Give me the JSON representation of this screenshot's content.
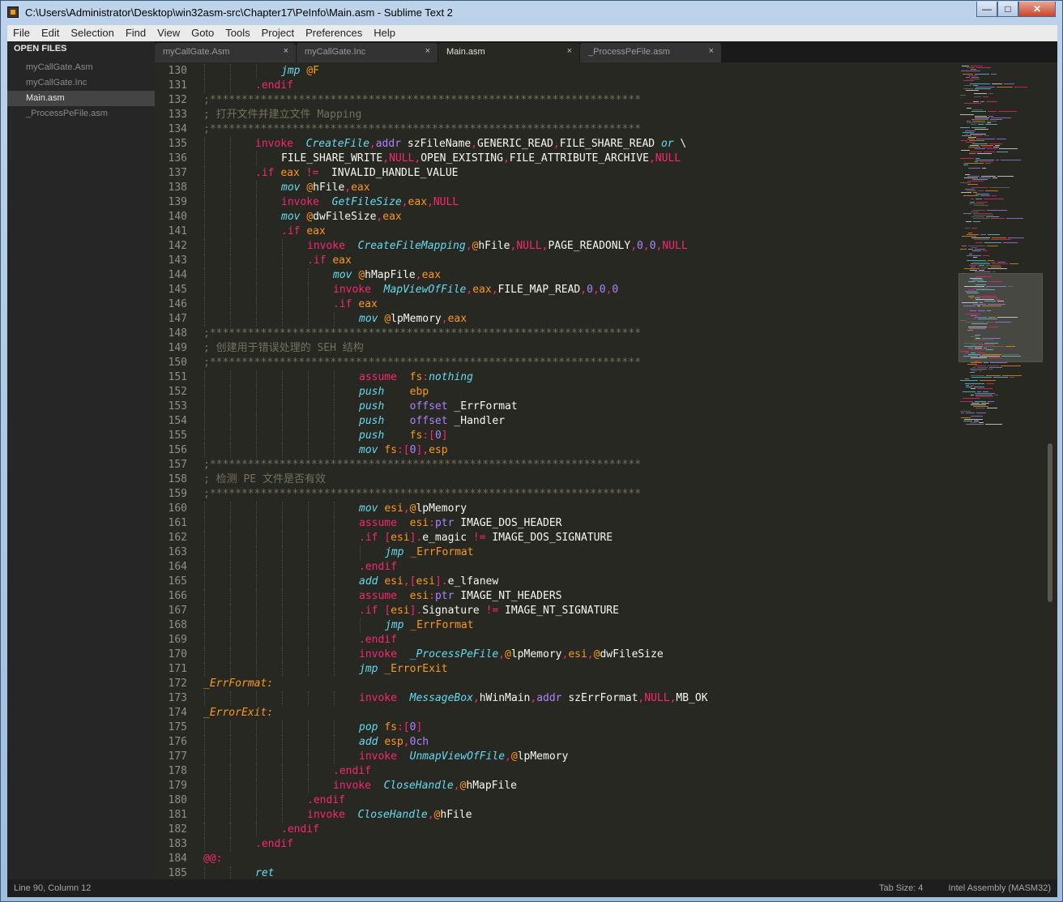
{
  "window": {
    "title": "C:\\Users\\Administrator\\Desktop\\win32asm-src\\Chapter17\\PeInfo\\Main.asm - Sublime Text 2"
  },
  "menu": [
    "File",
    "Edit",
    "Selection",
    "Find",
    "View",
    "Goto",
    "Tools",
    "Project",
    "Preferences",
    "Help"
  ],
  "sidebar": {
    "header": "OPEN FILES",
    "items": [
      "myCallGate.Asm",
      "myCallGate.Inc",
      "Main.asm",
      "_ProcessPeFile.asm"
    ],
    "active_index": 2
  },
  "tabs": [
    "myCallGate.Asm",
    "myCallGate.Inc",
    "Main.asm",
    "_ProcessPeFile.asm"
  ],
  "active_tab": 2,
  "tab_close_glyph": "×",
  "colors": {
    "keyword": "#f92672",
    "function": "#66d9ef",
    "directive": "#ae81ff",
    "string_like": "#fd971f",
    "comment": "#75715e",
    "plain": "#f8f8f2",
    "number": "#ae81ff",
    "background": "#272822"
  },
  "code_lines": [
    {
      "n": 130,
      "indent": 3,
      "tokens": [
        [
          "jmp",
          "fn"
        ],
        [
          " ",
          "p"
        ],
        [
          "@F",
          "or"
        ]
      ]
    },
    {
      "n": 131,
      "indent": 2,
      "tokens": [
        [
          ".endif",
          "kw"
        ]
      ]
    },
    {
      "n": 132,
      "indent": 0,
      "tokens": [
        [
          ";********************************************************************",
          "cm"
        ]
      ]
    },
    {
      "n": 133,
      "indent": 0,
      "tokens": [
        [
          "; 打开文件并建立文件 Mapping",
          "cm"
        ]
      ]
    },
    {
      "n": 134,
      "indent": 0,
      "tokens": [
        [
          ";********************************************************************",
          "cm"
        ]
      ]
    },
    {
      "n": 135,
      "indent": 2,
      "tokens": [
        [
          "invoke",
          "kw"
        ],
        [
          "  ",
          "p"
        ],
        [
          "CreateFile",
          "fn"
        ],
        [
          ",",
          "kw"
        ],
        [
          "addr",
          "di"
        ],
        [
          " szFileName",
          "p"
        ],
        [
          ",",
          "kw"
        ],
        [
          "GENERIC_READ",
          "p"
        ],
        [
          ",",
          "kw"
        ],
        [
          "FILE_SHARE_READ ",
          "p"
        ],
        [
          "or",
          "fn"
        ],
        [
          " \\",
          "p"
        ]
      ]
    },
    {
      "n": 136,
      "indent": 3,
      "tokens": [
        [
          "FILE_SHARE_WRITE",
          "p"
        ],
        [
          ",",
          "kw"
        ],
        [
          "NULL",
          "kw"
        ],
        [
          ",",
          "kw"
        ],
        [
          "OPEN_EXISTING",
          "p"
        ],
        [
          ",",
          "kw"
        ],
        [
          "FILE_ATTRIBUTE_ARCHIVE",
          "p"
        ],
        [
          ",",
          "kw"
        ],
        [
          "NULL",
          "kw"
        ]
      ]
    },
    {
      "n": 137,
      "indent": 2,
      "tokens": [
        [
          ".if",
          "kw"
        ],
        [
          " ",
          "p"
        ],
        [
          "eax",
          "or"
        ],
        [
          " ",
          "p"
        ],
        [
          "!=",
          "kw"
        ],
        [
          "  INVALID_HANDLE_VALUE",
          "p"
        ]
      ]
    },
    {
      "n": 138,
      "indent": 3,
      "tokens": [
        [
          "mov",
          "fn"
        ],
        [
          " ",
          "p"
        ],
        [
          "@",
          "or"
        ],
        [
          "hFile",
          "p"
        ],
        [
          ",",
          "kw"
        ],
        [
          "eax",
          "or"
        ]
      ]
    },
    {
      "n": 139,
      "indent": 3,
      "tokens": [
        [
          "invoke",
          "kw"
        ],
        [
          "  ",
          "p"
        ],
        [
          "GetFileSize",
          "fn"
        ],
        [
          ",",
          "kw"
        ],
        [
          "eax",
          "or"
        ],
        [
          ",",
          "kw"
        ],
        [
          "NULL",
          "kw"
        ]
      ]
    },
    {
      "n": 140,
      "indent": 3,
      "tokens": [
        [
          "mov",
          "fn"
        ],
        [
          " ",
          "p"
        ],
        [
          "@",
          "or"
        ],
        [
          "dwFileSize",
          "p"
        ],
        [
          ",",
          "kw"
        ],
        [
          "eax",
          "or"
        ]
      ]
    },
    {
      "n": 141,
      "indent": 3,
      "tokens": [
        [
          ".if",
          "kw"
        ],
        [
          " ",
          "p"
        ],
        [
          "eax",
          "or"
        ]
      ]
    },
    {
      "n": 142,
      "indent": 4,
      "tokens": [
        [
          "invoke",
          "kw"
        ],
        [
          "  ",
          "p"
        ],
        [
          "CreateFileMapping",
          "fn"
        ],
        [
          ",",
          "kw"
        ],
        [
          "@",
          "or"
        ],
        [
          "hFile",
          "p"
        ],
        [
          ",",
          "kw"
        ],
        [
          "NULL",
          "kw"
        ],
        [
          ",",
          "kw"
        ],
        [
          "PAGE_READONLY",
          "p"
        ],
        [
          ",",
          "kw"
        ],
        [
          "0",
          "di"
        ],
        [
          ",",
          "kw"
        ],
        [
          "0",
          "di"
        ],
        [
          ",",
          "kw"
        ],
        [
          "NULL",
          "kw"
        ]
      ]
    },
    {
      "n": 143,
      "indent": 4,
      "tokens": [
        [
          ".if",
          "kw"
        ],
        [
          " ",
          "p"
        ],
        [
          "eax",
          "or"
        ]
      ]
    },
    {
      "n": 144,
      "indent": 5,
      "tokens": [
        [
          "mov",
          "fn"
        ],
        [
          " ",
          "p"
        ],
        [
          "@",
          "or"
        ],
        [
          "hMapFile",
          "p"
        ],
        [
          ",",
          "kw"
        ],
        [
          "eax",
          "or"
        ]
      ]
    },
    {
      "n": 145,
      "indent": 5,
      "tokens": [
        [
          "invoke",
          "kw"
        ],
        [
          "  ",
          "p"
        ],
        [
          "MapViewOfFile",
          "fn"
        ],
        [
          ",",
          "kw"
        ],
        [
          "eax",
          "or"
        ],
        [
          ",",
          "kw"
        ],
        [
          "FILE_MAP_READ",
          "p"
        ],
        [
          ",",
          "kw"
        ],
        [
          "0",
          "di"
        ],
        [
          ",",
          "kw"
        ],
        [
          "0",
          "di"
        ],
        [
          ",",
          "kw"
        ],
        [
          "0",
          "di"
        ]
      ]
    },
    {
      "n": 146,
      "indent": 5,
      "tokens": [
        [
          ".if",
          "kw"
        ],
        [
          " ",
          "p"
        ],
        [
          "eax",
          "or"
        ]
      ]
    },
    {
      "n": 147,
      "indent": 6,
      "tokens": [
        [
          "mov",
          "fn"
        ],
        [
          " ",
          "p"
        ],
        [
          "@",
          "or"
        ],
        [
          "lpMemory",
          "p"
        ],
        [
          ",",
          "kw"
        ],
        [
          "eax",
          "or"
        ]
      ]
    },
    {
      "n": 148,
      "indent": 0,
      "tokens": [
        [
          ";********************************************************************",
          "cm"
        ]
      ]
    },
    {
      "n": 149,
      "indent": 0,
      "tokens": [
        [
          "; 创建用于错误处理的 SEH 结构",
          "cm"
        ]
      ]
    },
    {
      "n": 150,
      "indent": 0,
      "tokens": [
        [
          ";********************************************************************",
          "cm"
        ]
      ]
    },
    {
      "n": 151,
      "indent": 6,
      "tokens": [
        [
          "assume",
          "kw"
        ],
        [
          "  ",
          "p"
        ],
        [
          "fs",
          "or"
        ],
        [
          ":",
          "kw"
        ],
        [
          "nothing",
          "fn"
        ]
      ]
    },
    {
      "n": 152,
      "indent": 6,
      "tokens": [
        [
          "push",
          "fn"
        ],
        [
          "    ",
          "p"
        ],
        [
          "ebp",
          "or"
        ]
      ]
    },
    {
      "n": 153,
      "indent": 6,
      "tokens": [
        [
          "push",
          "fn"
        ],
        [
          "    ",
          "p"
        ],
        [
          "offset",
          "di"
        ],
        [
          " _ErrFormat",
          "p"
        ]
      ]
    },
    {
      "n": 154,
      "indent": 6,
      "tokens": [
        [
          "push",
          "fn"
        ],
        [
          "    ",
          "p"
        ],
        [
          "offset",
          "di"
        ],
        [
          " _Handler",
          "p"
        ]
      ]
    },
    {
      "n": 155,
      "indent": 6,
      "tokens": [
        [
          "push",
          "fn"
        ],
        [
          "    ",
          "p"
        ],
        [
          "fs",
          "or"
        ],
        [
          ":[",
          "kw"
        ],
        [
          "0",
          "di"
        ],
        [
          "]",
          "kw"
        ]
      ]
    },
    {
      "n": 156,
      "indent": 6,
      "tokens": [
        [
          "mov",
          "fn"
        ],
        [
          " ",
          "p"
        ],
        [
          "fs",
          "or"
        ],
        [
          ":[",
          "kw"
        ],
        [
          "0",
          "di"
        ],
        [
          "],",
          "kw"
        ],
        [
          "esp",
          "or"
        ]
      ]
    },
    {
      "n": 157,
      "indent": 0,
      "tokens": [
        [
          ";********************************************************************",
          "cm"
        ]
      ]
    },
    {
      "n": 158,
      "indent": 0,
      "tokens": [
        [
          "; 检测 PE 文件是否有效",
          "cm"
        ]
      ]
    },
    {
      "n": 159,
      "indent": 0,
      "tokens": [
        [
          ";********************************************************************",
          "cm"
        ]
      ]
    },
    {
      "n": 160,
      "indent": 6,
      "tokens": [
        [
          "mov",
          "fn"
        ],
        [
          " ",
          "p"
        ],
        [
          "esi",
          "or"
        ],
        [
          ",",
          "kw"
        ],
        [
          "@",
          "or"
        ],
        [
          "lpMemory",
          "p"
        ]
      ]
    },
    {
      "n": 161,
      "indent": 6,
      "tokens": [
        [
          "assume",
          "kw"
        ],
        [
          "  ",
          "p"
        ],
        [
          "esi",
          "or"
        ],
        [
          ":",
          "kw"
        ],
        [
          "ptr",
          "di"
        ],
        [
          " IMAGE_DOS_HEADER",
          "p"
        ]
      ]
    },
    {
      "n": 162,
      "indent": 6,
      "tokens": [
        [
          ".if",
          "kw"
        ],
        [
          " ",
          "p"
        ],
        [
          "[",
          "kw"
        ],
        [
          "esi",
          "or"
        ],
        [
          "].",
          "kw"
        ],
        [
          "e_magic ",
          "p"
        ],
        [
          "!=",
          "kw"
        ],
        [
          " IMAGE_DOS_SIGNATURE",
          "p"
        ]
      ]
    },
    {
      "n": 163,
      "indent": 7,
      "tokens": [
        [
          "jmp",
          "fn"
        ],
        [
          " ",
          "p"
        ],
        [
          "_ErrFormat",
          "or"
        ]
      ]
    },
    {
      "n": 164,
      "indent": 6,
      "tokens": [
        [
          ".endif",
          "kw"
        ]
      ]
    },
    {
      "n": 165,
      "indent": 6,
      "tokens": [
        [
          "add",
          "fn"
        ],
        [
          " ",
          "p"
        ],
        [
          "esi",
          "or"
        ],
        [
          ",[",
          "kw"
        ],
        [
          "esi",
          "or"
        ],
        [
          "].",
          "kw"
        ],
        [
          "e_lfanew",
          "p"
        ]
      ]
    },
    {
      "n": 166,
      "indent": 6,
      "tokens": [
        [
          "assume",
          "kw"
        ],
        [
          "  ",
          "p"
        ],
        [
          "esi",
          "or"
        ],
        [
          ":",
          "kw"
        ],
        [
          "ptr",
          "di"
        ],
        [
          " IMAGE_NT_HEADERS",
          "p"
        ]
      ]
    },
    {
      "n": 167,
      "indent": 6,
      "tokens": [
        [
          ".if",
          "kw"
        ],
        [
          " ",
          "p"
        ],
        [
          "[",
          "kw"
        ],
        [
          "esi",
          "or"
        ],
        [
          "].",
          "kw"
        ],
        [
          "Signature ",
          "p"
        ],
        [
          "!=",
          "kw"
        ],
        [
          " IMAGE_NT_SIGNATURE",
          "p"
        ]
      ]
    },
    {
      "n": 168,
      "indent": 7,
      "tokens": [
        [
          "jmp",
          "fn"
        ],
        [
          " ",
          "p"
        ],
        [
          "_ErrFormat",
          "or"
        ]
      ]
    },
    {
      "n": 169,
      "indent": 6,
      "tokens": [
        [
          ".endif",
          "kw"
        ]
      ]
    },
    {
      "n": 170,
      "indent": 6,
      "tokens": [
        [
          "invoke",
          "kw"
        ],
        [
          "  ",
          "p"
        ],
        [
          "_ProcessPeFile",
          "fn"
        ],
        [
          ",",
          "kw"
        ],
        [
          "@",
          "or"
        ],
        [
          "lpMemory",
          "p"
        ],
        [
          ",",
          "kw"
        ],
        [
          "esi",
          "or"
        ],
        [
          ",",
          "kw"
        ],
        [
          "@",
          "or"
        ],
        [
          "dwFileSize",
          "p"
        ]
      ]
    },
    {
      "n": 171,
      "indent": 6,
      "tokens": [
        [
          "jmp",
          "fn"
        ],
        [
          " ",
          "p"
        ],
        [
          "_ErrorExit",
          "or"
        ]
      ]
    },
    {
      "n": 172,
      "indent": 0,
      "tokens": [
        [
          "_ErrFormat:",
          "lb"
        ]
      ]
    },
    {
      "n": 173,
      "indent": 6,
      "tokens": [
        [
          "invoke",
          "kw"
        ],
        [
          "  ",
          "p"
        ],
        [
          "MessageBox",
          "fn"
        ],
        [
          ",",
          "kw"
        ],
        [
          "hWinMain",
          "p"
        ],
        [
          ",",
          "kw"
        ],
        [
          "addr",
          "di"
        ],
        [
          " szErrFormat",
          "p"
        ],
        [
          ",",
          "kw"
        ],
        [
          "NULL",
          "kw"
        ],
        [
          ",",
          "kw"
        ],
        [
          "MB_OK",
          "p"
        ]
      ]
    },
    {
      "n": 174,
      "indent": 0,
      "tokens": [
        [
          "_ErrorExit:",
          "lb"
        ]
      ]
    },
    {
      "n": 175,
      "indent": 6,
      "tokens": [
        [
          "pop",
          "fn"
        ],
        [
          " ",
          "p"
        ],
        [
          "fs",
          "or"
        ],
        [
          ":[",
          "kw"
        ],
        [
          "0",
          "di"
        ],
        [
          "]",
          "kw"
        ]
      ]
    },
    {
      "n": 176,
      "indent": 6,
      "tokens": [
        [
          "add",
          "fn"
        ],
        [
          " ",
          "p"
        ],
        [
          "esp",
          "or"
        ],
        [
          ",",
          "kw"
        ],
        [
          "0ch",
          "di"
        ]
      ]
    },
    {
      "n": 177,
      "indent": 6,
      "tokens": [
        [
          "invoke",
          "kw"
        ],
        [
          "  ",
          "p"
        ],
        [
          "UnmapViewOfFile",
          "fn"
        ],
        [
          ",",
          "kw"
        ],
        [
          "@",
          "or"
        ],
        [
          "lpMemory",
          "p"
        ]
      ]
    },
    {
      "n": 178,
      "indent": 5,
      "tokens": [
        [
          ".endif",
          "kw"
        ]
      ]
    },
    {
      "n": 179,
      "indent": 5,
      "tokens": [
        [
          "invoke",
          "kw"
        ],
        [
          "  ",
          "p"
        ],
        [
          "CloseHandle",
          "fn"
        ],
        [
          ",",
          "kw"
        ],
        [
          "@",
          "or"
        ],
        [
          "hMapFile",
          "p"
        ]
      ]
    },
    {
      "n": 180,
      "indent": 4,
      "tokens": [
        [
          ".endif",
          "kw"
        ]
      ]
    },
    {
      "n": 181,
      "indent": 4,
      "tokens": [
        [
          "invoke",
          "kw"
        ],
        [
          "  ",
          "p"
        ],
        [
          "CloseHandle",
          "fn"
        ],
        [
          ",",
          "kw"
        ],
        [
          "@",
          "or"
        ],
        [
          "hFile",
          "p"
        ]
      ]
    },
    {
      "n": 182,
      "indent": 3,
      "tokens": [
        [
          ".endif",
          "kw"
        ]
      ]
    },
    {
      "n": 183,
      "indent": 2,
      "tokens": [
        [
          ".endif",
          "kw"
        ]
      ]
    },
    {
      "n": 184,
      "indent": 0,
      "tokens": [
        [
          "@@:",
          "lb2"
        ]
      ]
    },
    {
      "n": 185,
      "indent": 2,
      "tokens": [
        [
          "ret",
          "fn"
        ]
      ]
    }
  ],
  "status": {
    "position": "Line 90, Column 12",
    "tab_size": "Tab Size: 4",
    "syntax": "Intel Assembly (MASM32)"
  }
}
